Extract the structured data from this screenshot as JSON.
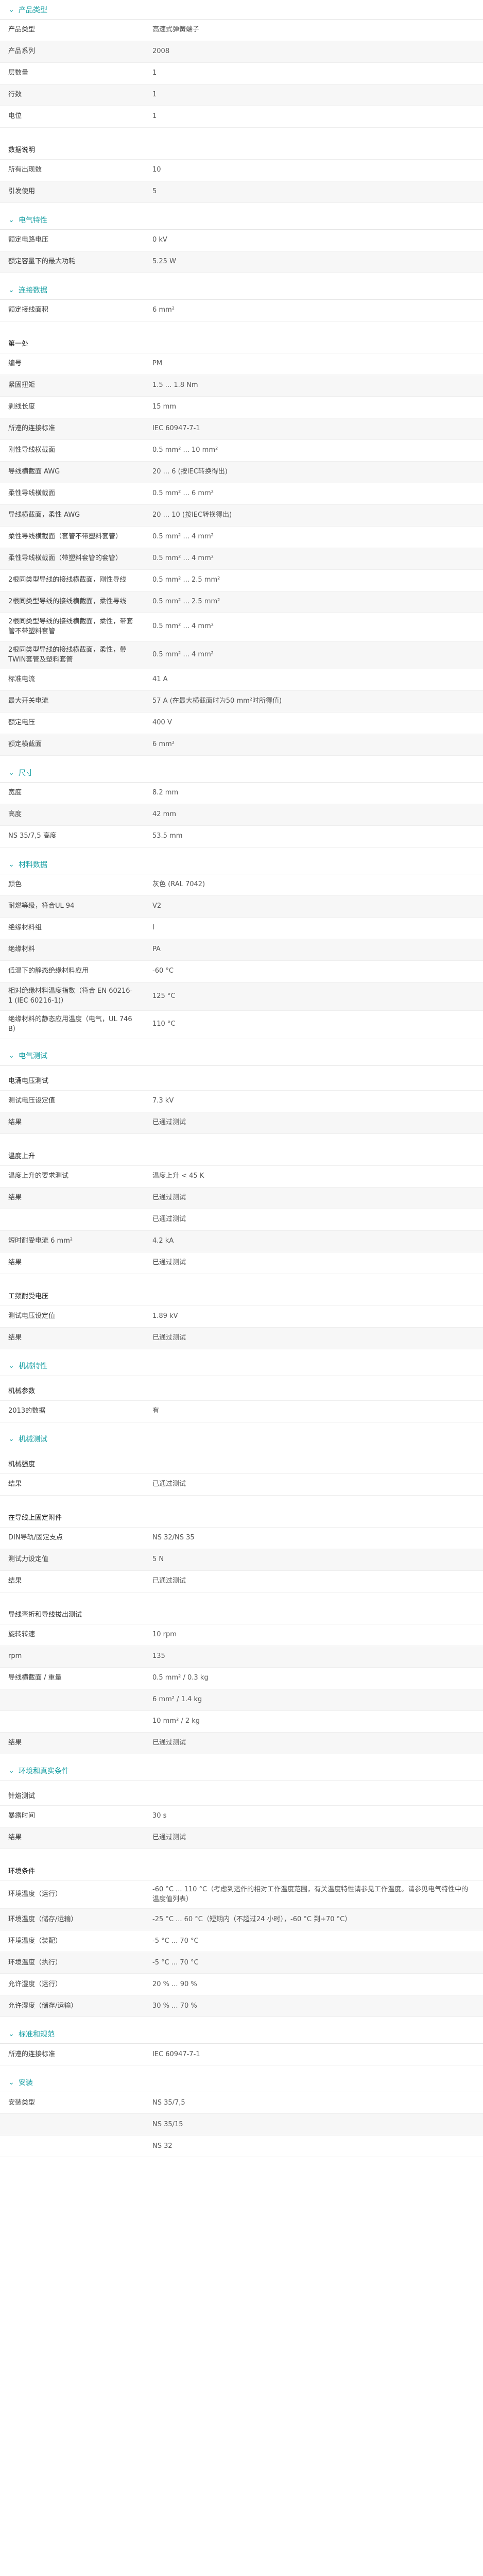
{
  "sections": [
    {
      "title": "产品类型",
      "blocks": [
        {
          "rows": [
            {
              "label": "产品类型",
              "value": "高速式弹簧端子"
            },
            {
              "label": "产品系列",
              "value": "2008"
            },
            {
              "label": "层数量",
              "value": "1"
            },
            {
              "label": "行数",
              "value": "1"
            },
            {
              "label": "电位",
              "value": "1"
            }
          ]
        },
        {
          "subtitle": "数据说明",
          "rows": [
            {
              "label": "所有出现数",
              "value": "10"
            },
            {
              "label": "引发使用",
              "value": "5"
            }
          ]
        }
      ]
    },
    {
      "title": "电气特性",
      "blocks": [
        {
          "rows": [
            {
              "label": "额定电路电压",
              "value": "0 kV"
            },
            {
              "label": "额定容量下的最大功耗",
              "value": "5.25 W"
            }
          ]
        }
      ]
    },
    {
      "title": "连接数据",
      "blocks": [
        {
          "rows": [
            {
              "label": "额定接线面积",
              "value": "6 mm²"
            }
          ]
        },
        {
          "subtitle": "第一处",
          "rows": [
            {
              "label": "编号",
              "value": "PM"
            },
            {
              "label": "紧固扭矩",
              "value": "1.5 ... 1.8 Nm"
            },
            {
              "label": "剥线长度",
              "value": "15 mm"
            },
            {
              "label": "所遵的连接标准",
              "value": "IEC 60947-7-1"
            },
            {
              "label": "刚性导线横截面",
              "value": "0.5 mm² ... 10 mm²"
            },
            {
              "label": "导线横截面 AWG",
              "value": "20 ... 6 (按IEC转换得出)"
            },
            {
              "label": "柔性导线横截面",
              "value": "0.5 mm² ... 6 mm²"
            },
            {
              "label": "导线横截面，柔性 AWG",
              "value": "20 ... 10 (按IEC转换得出)"
            },
            {
              "label": "柔性导线横截面（套管不带塑料套管）",
              "value": "0.5 mm² ... 4 mm²"
            },
            {
              "label": "柔性导线横截面（带塑料套管的套管）",
              "value": "0.5 mm² ... 4 mm²"
            },
            {
              "label": "2根同类型导线的接线横截面，刚性导线",
              "value": "0.5 mm² ... 2.5 mm²"
            },
            {
              "label": "2根同类型导线的接线横截面，柔性导线",
              "value": "0.5 mm² ... 2.5 mm²"
            },
            {
              "label": "2根同类型导线的接线横截面，柔性，带套管不带塑料套管",
              "value": "0.5 mm² ... 4 mm²"
            },
            {
              "label": "2根同类型导线的接线横截面，柔性，带TWIN套管及塑料套管",
              "value": "0.5 mm² ... 4 mm²"
            },
            {
              "label": "标准电流",
              "value": "41 A"
            },
            {
              "label": "最大开关电流",
              "value": "57 A (在最大横截面时为50 mm²时所得值)"
            },
            {
              "label": "额定电压",
              "value": "400 V"
            },
            {
              "label": "额定横截面",
              "value": "6 mm²"
            }
          ]
        }
      ]
    },
    {
      "title": "尺寸",
      "blocks": [
        {
          "rows": [
            {
              "label": "宽度",
              "value": "8.2 mm"
            },
            {
              "label": "高度",
              "value": "42 mm"
            },
            {
              "label": "NS 35/7,5 高度",
              "value": "53.5 mm"
            }
          ]
        }
      ]
    },
    {
      "title": "材料数据",
      "blocks": [
        {
          "rows": [
            {
              "label": "颜色",
              "value": "灰色 (RAL 7042)"
            },
            {
              "label": "耐燃等级，符合UL 94",
              "value": "V2"
            },
            {
              "label": "绝缘材料组",
              "value": "I"
            },
            {
              "label": "绝缘材料",
              "value": "PA"
            },
            {
              "label": "低温下的静态绝缘材料应用",
              "value": "-60 °C"
            },
            {
              "label": "相对绝缘材料温度指数（符合 EN 60216-1 (IEC 60216-1)）",
              "value": "125 °C"
            },
            {
              "label": "绝缘材料的静态应用温度（电气，UL 746 B）",
              "value": "110 °C"
            }
          ]
        }
      ]
    },
    {
      "title": "电气测试",
      "blocks": [
        {
          "subtitle": "电涌电压测试",
          "rows": [
            {
              "label": "测试电压设定值",
              "value": "7.3 kV"
            },
            {
              "label": "结果",
              "value": "已通过测试"
            }
          ]
        },
        {
          "subtitle": "温度上升",
          "rows": [
            {
              "label": "温度上升的要求测试",
              "value": "温度上升 < 45 K"
            },
            {
              "label": "结果",
              "value": "已通过测试"
            },
            {
              "label": "",
              "value": "已通过测试"
            },
            {
              "label": "短时耐受电流 6 mm²",
              "value": "4.2 kA"
            },
            {
              "label": "结果",
              "value": "已通过测试"
            }
          ]
        },
        {
          "subtitle": "工频耐受电压",
          "rows": [
            {
              "label": "测试电压设定值",
              "value": "1.89 kV"
            },
            {
              "label": "结果",
              "value": "已通过测试"
            }
          ]
        }
      ]
    },
    {
      "title": "机械特性",
      "blocks": [
        {
          "subtitle": "机械参数",
          "rows": [
            {
              "label": "2013的数据",
              "value": "有"
            }
          ]
        }
      ]
    },
    {
      "title": "机械测试",
      "blocks": [
        {
          "subtitle": "机械强度",
          "rows": [
            {
              "label": "结果",
              "value": "已通过测试"
            }
          ]
        },
        {
          "subtitle": "在导线上固定附件",
          "rows": [
            {
              "label": "DIN导轨/固定支点",
              "value": "NS 32/NS 35"
            },
            {
              "label": "测试力设定值",
              "value": "5 N"
            },
            {
              "label": "结果",
              "value": "已通过测试"
            }
          ]
        },
        {
          "subtitle": "导线弯折和导线拔出测试",
          "rows": [
            {
              "label": "旋转转速",
              "value": "10 rpm"
            },
            {
              "label": "rpm",
              "value": "135"
            },
            {
              "label": "导线横截面 / 重量",
              "value": "0.5 mm² / 0.3 kg"
            },
            {
              "label": "",
              "value": "6 mm² / 1.4 kg"
            },
            {
              "label": "",
              "value": "10 mm² / 2 kg"
            },
            {
              "label": "结果",
              "value": "已通过测试"
            }
          ]
        }
      ]
    },
    {
      "title": "环境和真实条件",
      "blocks": [
        {
          "subtitle": "针焰测试",
          "rows": [
            {
              "label": "暴露时间",
              "value": "30 s"
            },
            {
              "label": "结果",
              "value": "已通过测试"
            }
          ]
        },
        {
          "subtitle": "环境条件",
          "rows": [
            {
              "label": "环境温度（运行）",
              "value": "-60 °C ... 110 °C（考虑到运作的相对工作温度范围，有关温度特性请参见工作温度。请参见电气特性中的温度值列表）"
            },
            {
              "label": "环境温度（储存/运输）",
              "value": "-25 °C ... 60 °C（短期内（不超过24 小时），-60 °C 到+70 °C）"
            },
            {
              "label": "环境温度（装配）",
              "value": "-5 °C ... 70 °C"
            },
            {
              "label": "环境温度（执行）",
              "value": "-5 °C ... 70 °C"
            },
            {
              "label": "允许湿度（运行）",
              "value": "20 % ... 90 %"
            },
            {
              "label": "允许湿度（储存/运输）",
              "value": "30 % ... 70 %"
            }
          ]
        }
      ]
    },
    {
      "title": "标准和规范",
      "blocks": [
        {
          "rows": [
            {
              "label": "所遵的连接标准",
              "value": "IEC 60947-7-1"
            }
          ]
        }
      ]
    },
    {
      "title": "安装",
      "blocks": [
        {
          "rows": [
            {
              "label": "安装类型",
              "value": "NS 35/7,5"
            },
            {
              "label": "",
              "value": "NS 35/15"
            },
            {
              "label": "",
              "value": "NS 32"
            }
          ]
        }
      ]
    }
  ],
  "colors": {
    "accent": "#1ba0a4",
    "zebra": "#f7f7f7",
    "rule": "#eeeeee"
  },
  "icons": {
    "section_toggle": "chevron-down-icon"
  }
}
